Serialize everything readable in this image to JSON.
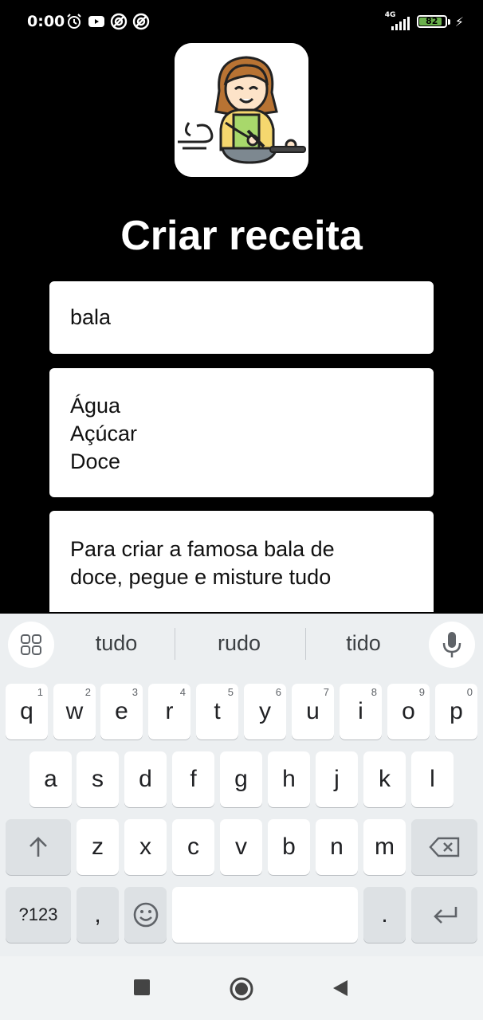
{
  "status": {
    "time": "0:00",
    "network": "4G",
    "battery": "82"
  },
  "app": {
    "title": "Criar receita"
  },
  "form": {
    "name_value": "bala",
    "ingredients_lines": [
      "Água",
      "Açúcar",
      "Doce"
    ],
    "steps_lines": [
      "Para criar a famosa bala de",
      "doce, pegue e misture tudo"
    ]
  },
  "keyboard": {
    "suggestions": [
      "tudo",
      "rudo",
      "tido"
    ],
    "row1": [
      {
        "k": "q",
        "h": "1"
      },
      {
        "k": "w",
        "h": "2"
      },
      {
        "k": "e",
        "h": "3"
      },
      {
        "k": "r",
        "h": "4"
      },
      {
        "k": "t",
        "h": "5"
      },
      {
        "k": "y",
        "h": "6"
      },
      {
        "k": "u",
        "h": "7"
      },
      {
        "k": "i",
        "h": "8"
      },
      {
        "k": "o",
        "h": "9"
      },
      {
        "k": "p",
        "h": "0"
      }
    ],
    "row2": [
      "a",
      "s",
      "d",
      "f",
      "g",
      "h",
      "j",
      "k",
      "l"
    ],
    "row3": [
      "z",
      "x",
      "c",
      "v",
      "b",
      "n",
      "m"
    ],
    "symbols_label": "?123",
    "comma_label": ",",
    "period_label": "."
  },
  "icons": {
    "status": [
      "alarm-icon",
      "youtube-icon",
      "app-icon",
      "app-icon"
    ],
    "suggestions_left": "grid-icon",
    "suggestions_right": "mic-icon",
    "shift": "shift-up-icon",
    "backspace": "backspace-icon",
    "emoji": "emoji-icon",
    "enter": "enter-icon",
    "nav": [
      "recents-square-icon",
      "home-circle-icon",
      "back-triangle-icon"
    ]
  },
  "colors": {
    "background": "#000000",
    "field": "#ffffff",
    "keyboard": "#eceff1",
    "battery": "#6ab04c"
  }
}
